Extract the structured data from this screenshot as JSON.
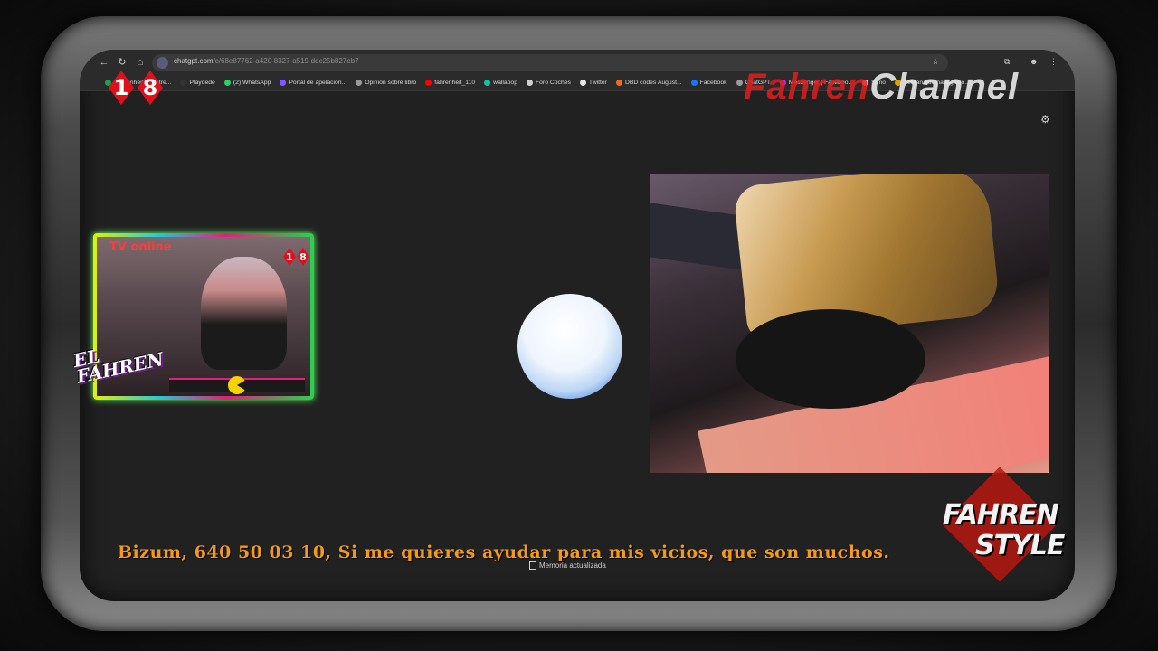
{
  "browser": {
    "url_host": "chatgpt.com",
    "url_path": "/c/68e87762-a420-8327-a519-ddc25b827eb7",
    "bookmarks": [
      {
        "label": "Fahrenheit_livestre...",
        "icon": "sheets-icon",
        "color": "#17a34a"
      },
      {
        "label": "Playdede",
        "icon": "play-icon",
        "color": "#333333"
      },
      {
        "label": "(2) WhatsApp",
        "icon": "whatsapp-icon",
        "color": "#25d366"
      },
      {
        "label": "Portal de apelacion...",
        "icon": "page-icon",
        "color": "#7c5cff"
      },
      {
        "label": "Opinión sobre libro",
        "icon": "chatgpt-icon",
        "color": "#9a9a9a"
      },
      {
        "label": "fahrenheit_110",
        "icon": "youtube-icon",
        "color": "#ff0000"
      },
      {
        "label": "wallapop",
        "icon": "wallapop-icon",
        "color": "#13c1ac"
      },
      {
        "label": "Foro Coches",
        "icon": "forocoches-icon",
        "color": "#cfcfcf"
      },
      {
        "label": "Twitter",
        "icon": "x-icon",
        "color": "#e8e8e8"
      },
      {
        "label": "DBD codes August...",
        "icon": "page-icon",
        "color": "#f26b1d"
      },
      {
        "label": "Facebook",
        "icon": "facebook-icon",
        "color": "#1877f2"
      },
      {
        "label": "ChatGPT",
        "icon": "chatgpt-icon",
        "color": "#9a9a9a"
      },
      {
        "label": "Messenger | Faceboo...",
        "icon": "messenger-icon",
        "color": "#a334fa"
      },
      {
        "label": "Suno",
        "icon": "suno-icon",
        "color": "#e8e8e8"
      },
      {
        "label": "Ventana de navegació...",
        "icon": "page-icon",
        "color": "#e0a000"
      }
    ]
  },
  "overlay": {
    "age_rating": [
      "1",
      "8"
    ],
    "channel_logo_part1": "Fahren",
    "channel_logo_part2": "Channel",
    "tv_label": "TV online",
    "tv_age_rating": [
      "1",
      "8"
    ],
    "el_fahren_line1": "EL",
    "el_fahren_line2": "FAHREN",
    "fahren_style_line1": "FAHREN",
    "fahren_style_line2": "STYLE",
    "ticker": "Bizum, 640 50 03 10,  Si me quieres ayudar para mis vicios, que son muchos."
  },
  "page": {
    "memory_status": "Memoria actualizada"
  }
}
